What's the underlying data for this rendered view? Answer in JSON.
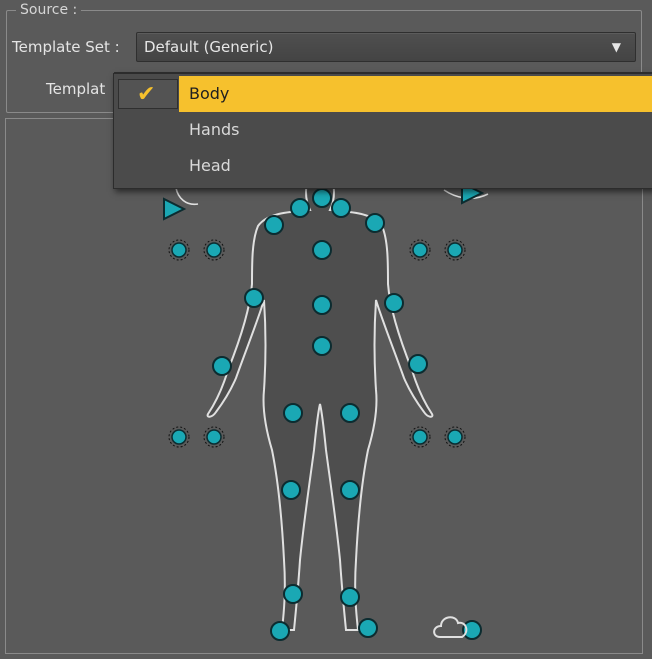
{
  "source": {
    "legend": "Source :",
    "template_set_label": "Template Set :",
    "template_set_value": "Default (Generic)",
    "template_label": "Templat"
  },
  "dropdown": {
    "items": [
      {
        "label": "Body",
        "selected": true
      },
      {
        "label": "Hands",
        "selected": false
      },
      {
        "label": "Head",
        "selected": false
      }
    ]
  },
  "colors": {
    "accent": "#f6c12d",
    "node_fill": "#1aa8b4",
    "node_stroke": "#0c2c30",
    "outline": "#e0e0e0"
  },
  "icons": {
    "combo_arrow": "chevron-down-icon",
    "checkmark": "checkmark-icon"
  }
}
